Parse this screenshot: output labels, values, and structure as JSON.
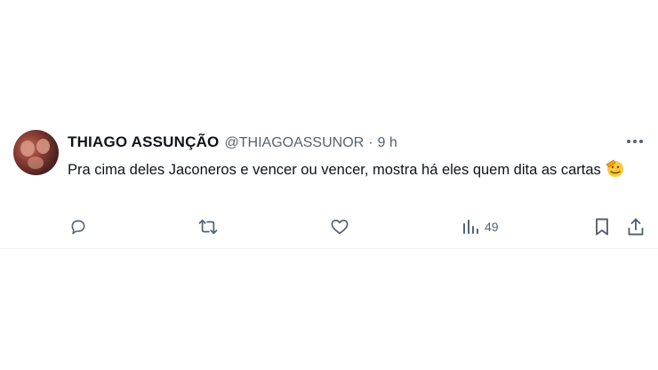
{
  "tweet": {
    "display_name": "THIAGO ASSUNÇÃO",
    "handle": "@THIAGOASSUNOR",
    "separator": "·",
    "time": "9 h",
    "text": "Pra cima deles Jaconeros e vencer ou vencer, mostra há eles quem dita as cartas",
    "emoji": "saluting-face-icon"
  },
  "actions": {
    "reply": {
      "icon": "reply-icon"
    },
    "retweet": {
      "icon": "retweet-icon"
    },
    "like": {
      "icon": "heart-icon"
    },
    "views": {
      "icon": "views-icon",
      "count": "49"
    },
    "bookmark": {
      "icon": "bookmark-icon"
    },
    "share": {
      "icon": "share-icon"
    }
  },
  "colors": {
    "text": "#0f1419",
    "secondary": "#536471",
    "divider": "#eff3f4",
    "emoji": "#ffc83d"
  }
}
